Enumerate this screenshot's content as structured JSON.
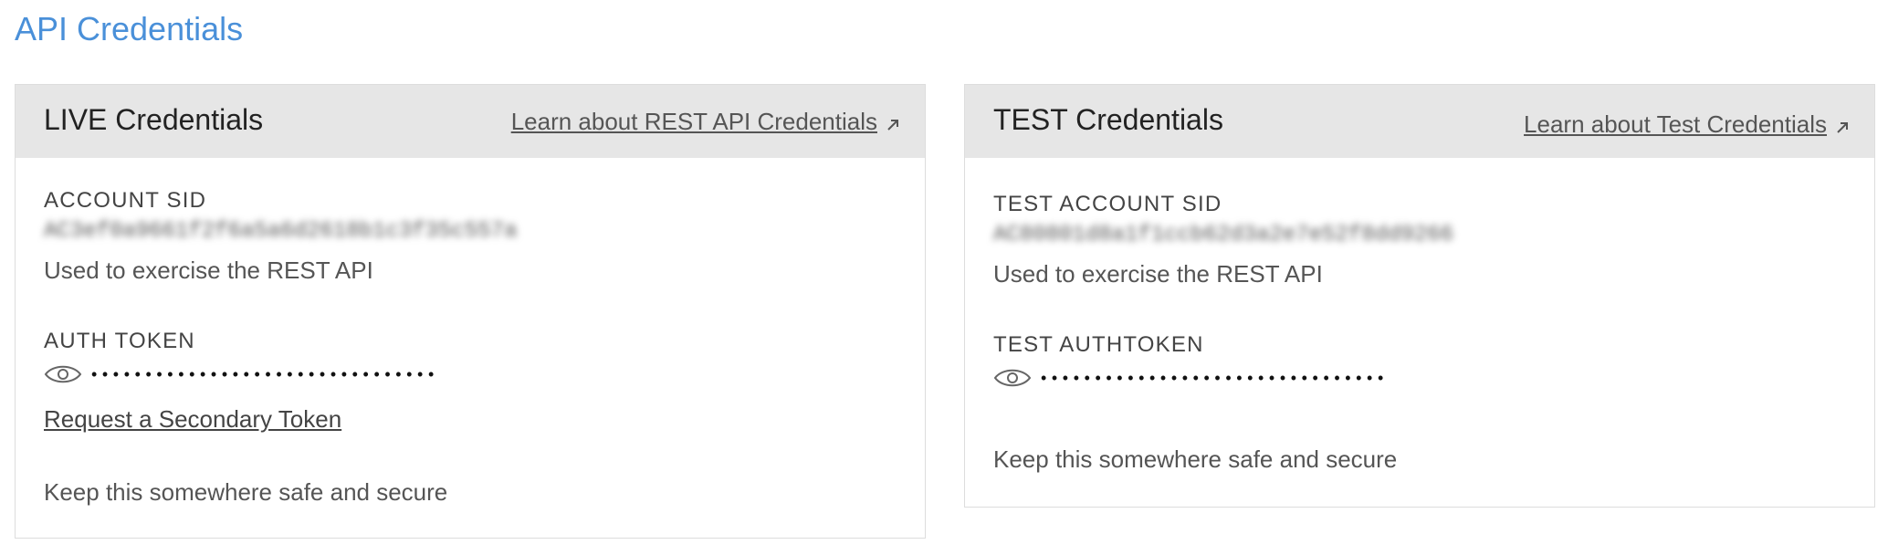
{
  "page": {
    "title": "API Credentials"
  },
  "live": {
    "title": "LIVE Credentials",
    "learn_link": "Learn about REST API Credentials",
    "sid_label": "ACCOUNT SID",
    "sid_value": "AC3ef0a9661f2f6a5a6d2618b1c3f35c557a",
    "sid_help": "Used to exercise the REST API",
    "token_label": "AUTH TOKEN",
    "token_masked": "••••••••••••••••••••••••••••••••",
    "secondary_link": "Request a Secondary Token",
    "token_help": "Keep this somewhere safe and secure"
  },
  "test": {
    "title": "TEST Credentials",
    "learn_link": "Learn about Test Credentials",
    "sid_label": "TEST ACCOUNT SID",
    "sid_value": "AC80801d8a1f1ccb62d3a2e7e52f8dd9266",
    "sid_help": "Used to exercise the REST API",
    "token_label": "TEST AUTHTOKEN",
    "token_masked": "••••••••••••••••••••••••••••••••",
    "token_help": "Keep this somewhere safe and secure"
  },
  "icons": {
    "external": "arrow-up-right-icon",
    "reveal": "eye-icon"
  },
  "colors": {
    "title_blue": "#4a90d9",
    "header_bg": "#e6e6e6",
    "border": "#dddddd"
  }
}
